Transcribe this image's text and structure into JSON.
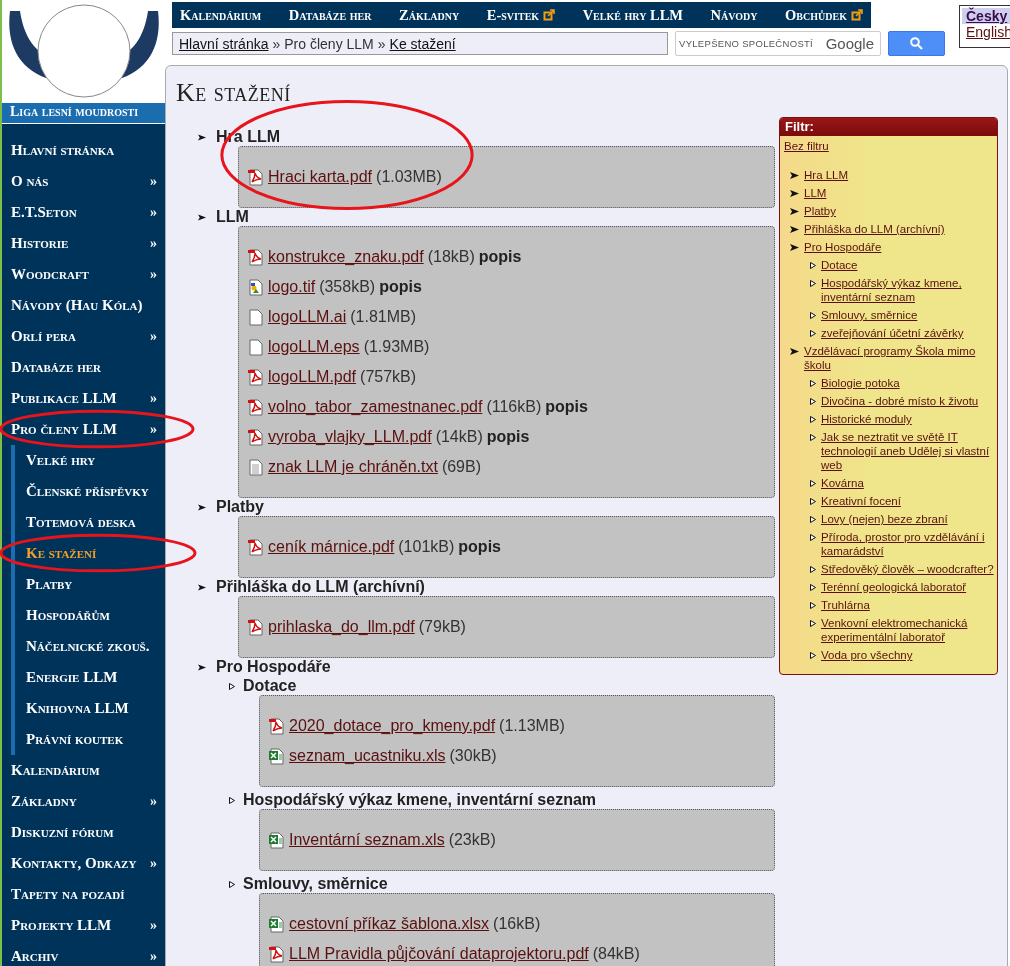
{
  "header": {
    "nav": [
      {
        "label": "Kalendárium",
        "external": false
      },
      {
        "label": "Databáze her",
        "external": false
      },
      {
        "label": "Základny",
        "external": false
      },
      {
        "label": "E-svitek",
        "external": true
      },
      {
        "label": "Velké hry LLM",
        "external": false
      },
      {
        "label": "Návody",
        "external": false
      },
      {
        "label": "Obchůdek",
        "external": true
      }
    ],
    "breadcrumb": [
      {
        "label": "Hlavní stránka",
        "link": true
      },
      {
        "separator": "»",
        "label": "Pro členy LLM",
        "link": false
      },
      {
        "separator": "»",
        "label": "Ke stažení",
        "link": true
      }
    ],
    "search": {
      "placeholder": "VYLEPŠENO SPOLEČNOSTÍ",
      "brand": "Google"
    },
    "languages": [
      {
        "label": "Česky",
        "selected": true
      },
      {
        "label": "English",
        "selected": false
      }
    ]
  },
  "sidebar": {
    "title": "Liga lesní moudrosti",
    "items": [
      {
        "label": "Hlavní stránka",
        "selected": false,
        "circled": false
      },
      {
        "label": "O nás",
        "submenu_mark": "»",
        "selected": false,
        "circled": false
      },
      {
        "label": "E.T.Seton",
        "submenu_mark": "»",
        "selected": false,
        "circled": false
      },
      {
        "label": "Historie",
        "submenu_mark": "»",
        "selected": false,
        "circled": false
      },
      {
        "label": "Woodcraft",
        "submenu_mark": "»",
        "selected": false,
        "circled": false
      },
      {
        "label": "Návody (Hau Kóla)",
        "selected": false,
        "circled": false
      },
      {
        "label": "Orlí pera",
        "submenu_mark": "»",
        "selected": false,
        "circled": false
      },
      {
        "label": "Databáze her",
        "selected": false,
        "circled": false
      },
      {
        "label": "Publikace LLM",
        "submenu_mark": "»",
        "selected": false,
        "circled": false
      },
      {
        "label": "Pro členy LLM",
        "submenu_mark": "»",
        "selected": false,
        "circled": true,
        "children": [
          {
            "label": "Velké hry",
            "selected": false,
            "circled": false
          },
          {
            "label": "Členské příspěvky",
            "selected": false,
            "circled": false
          },
          {
            "label": "Totemová deska",
            "selected": false,
            "circled": false
          },
          {
            "label": "Ke stažení",
            "selected": true,
            "circled": true
          },
          {
            "label": "Platby",
            "selected": false,
            "circled": false
          },
          {
            "label": "Hospodářům",
            "selected": false,
            "circled": false
          },
          {
            "label": "Náčelnické zkouš.",
            "selected": false,
            "circled": false
          },
          {
            "label": "Energie LLM",
            "selected": false,
            "circled": false
          },
          {
            "label": "Knihovna LLM",
            "selected": false,
            "circled": false
          },
          {
            "label": "Právní koutek",
            "selected": false,
            "circled": false
          }
        ]
      },
      {
        "label": "Kalendárium",
        "selected": false,
        "circled": false
      },
      {
        "label": "Základny",
        "submenu_mark": "»",
        "selected": false,
        "circled": false
      },
      {
        "label": "Diskuzní fórum",
        "selected": false,
        "circled": false
      },
      {
        "label": "Kontakty, Odkazy",
        "submenu_mark": "»",
        "selected": false,
        "circled": false
      },
      {
        "label": "Tapety na pozadí",
        "selected": false,
        "circled": false
      },
      {
        "label": "Projekty LLM",
        "submenu_mark": "»",
        "selected": false,
        "circled": false
      },
      {
        "label": "Archiv",
        "submenu_mark": "»",
        "selected": false,
        "circled": false
      }
    ]
  },
  "main": {
    "title": "Ke stažení",
    "groups": [
      {
        "title": "Hra LLM",
        "circled": true,
        "files": [
          {
            "kind": "pdf",
            "name": "Hraci karta.pdf",
            "size": "(1.03MB)"
          }
        ]
      },
      {
        "title": "LLM",
        "circled": false,
        "files": [
          {
            "kind": "pdf",
            "name": "konstrukce_znaku.pdf",
            "size": "(18kB)",
            "note": "popis"
          },
          {
            "kind": "image",
            "name": "logo.tif",
            "size": "(358kB)",
            "note": "popis"
          },
          {
            "kind": "blank",
            "name": "logoLLM.ai",
            "size": "(1.81MB)"
          },
          {
            "kind": "blank",
            "name": "logoLLM.eps",
            "size": "(1.93MB)"
          },
          {
            "kind": "pdf",
            "name": "logoLLM.pdf",
            "size": "(757kB)"
          },
          {
            "kind": "pdf",
            "name": "volno_tabor_zamestnanec.pdf",
            "size": "(116kB)",
            "note": "popis"
          },
          {
            "kind": "pdf",
            "name": "vyroba_vlajky_LLM.pdf",
            "size": "(14kB)",
            "note": "popis"
          },
          {
            "kind": "text",
            "name": "znak LLM je chráněn.txt",
            "size": "(69B)"
          }
        ]
      },
      {
        "title": "Platby",
        "circled": false,
        "files": [
          {
            "kind": "pdf",
            "name": "ceník márnice.pdf",
            "size": "(101kB)",
            "note": "popis"
          }
        ]
      },
      {
        "title": "Přihláška do LLM (archívní)",
        "circled": false,
        "files": [
          {
            "kind": "pdf",
            "name": "prihlaska_do_llm.pdf",
            "size": "(79kB)"
          }
        ]
      },
      {
        "title": "Pro Hospodáře",
        "circled": false,
        "subgroups": [
          {
            "title": "Dotace",
            "files": [
              {
                "kind": "pdf",
                "name": "2020_dotace_pro_kmeny.pdf",
                "size": "(1.13MB)"
              },
              {
                "kind": "excel",
                "name": "seznam_ucastniku.xls",
                "size": "(30kB)"
              }
            ]
          },
          {
            "title": "Hospodářský výkaz kmene, inventární seznam",
            "files": [
              {
                "kind": "excel",
                "name": "Inventární seznam.xls",
                "size": "(23kB)"
              }
            ]
          },
          {
            "title": "Smlouvy, směrnice",
            "files": [
              {
                "kind": "excel",
                "name": "cestovní příkaz šablona.xlsx",
                "size": "(16kB)"
              },
              {
                "kind": "pdf",
                "name": "LLM Pravidla půjčování dataprojektoru.pdf",
                "size": "(84kB)"
              }
            ]
          }
        ]
      }
    ]
  },
  "filter": {
    "title": "Filtr:",
    "reset": "Bez filtru",
    "items": [
      {
        "label": "Hra LLM"
      },
      {
        "label": "LLM"
      },
      {
        "label": "Platby"
      },
      {
        "label": "Přihláška do LLM (archívní)"
      },
      {
        "label": "Pro Hospodáře",
        "children": [
          {
            "label": "Dotace"
          },
          {
            "label": "Hospodářský výkaz kmene, inventární seznam"
          },
          {
            "label": "Smlouvy, směrnice"
          },
          {
            "label": "zveřejňování účetní závěrky"
          }
        ]
      },
      {
        "label": "Vzdělávací programy Škola mimo školu",
        "children": [
          {
            "label": "Biologie potoka"
          },
          {
            "label": "Divočina - dobré místo k životu"
          },
          {
            "label": "Historické moduly"
          },
          {
            "label": "Jak se neztratit ve světě IT technologií aneb Udělej si vlastní web"
          },
          {
            "label": "Kovárna"
          },
          {
            "label": "Kreativní focení"
          },
          {
            "label": "Lovy (nejen) beze zbraní"
          },
          {
            "label": "Příroda, prostor pro vzdělávání i kamarádství"
          },
          {
            "label": "Středověký člověk – woodcrafter?"
          },
          {
            "label": "Terénní geologická laboratoř"
          },
          {
            "label": "Truhlárna"
          },
          {
            "label": "Venkovní elektromechanická experimentální laboratoř"
          },
          {
            "label": "Voda pro všechny"
          }
        ]
      }
    ]
  }
}
